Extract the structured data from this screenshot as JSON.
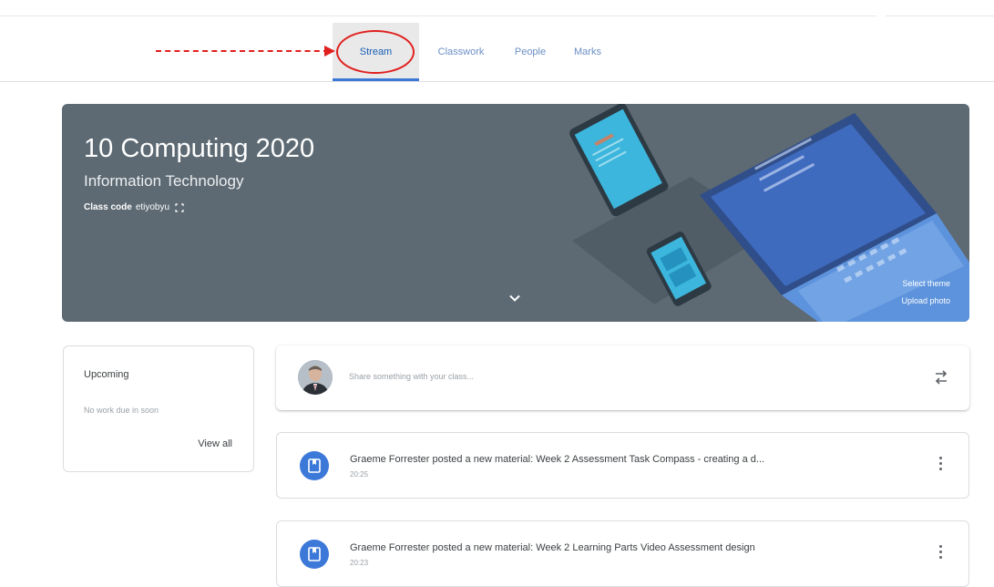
{
  "tabs": [
    {
      "label": "Stream",
      "active": true
    },
    {
      "label": "Classwork",
      "active": false
    },
    {
      "label": "People",
      "active": false
    },
    {
      "label": "Marks",
      "active": false
    }
  ],
  "banner": {
    "title": "10 Computing 2020",
    "subtitle": "Information Technology",
    "code_label": "Class code",
    "code_value": "etiyobyu",
    "select_theme": "Select theme",
    "upload_photo": "Upload photo",
    "background_color": "#5d6a73"
  },
  "upcoming": {
    "title": "Upcoming",
    "empty_text": "No work due in soon",
    "view_all": "View all"
  },
  "share": {
    "placeholder": "Share something with your class..."
  },
  "posts": [
    {
      "title": "Graeme Forrester posted a new material: Week 2 Assessment Task Compass - creating a d...",
      "time": "20:25"
    },
    {
      "title": "Graeme Forrester posted a new material: Week 2 Learning Parts Video Assessment design",
      "time": "20:23"
    }
  ],
  "colors": {
    "accent": "#3b78d8",
    "annotation": "#e0201e"
  },
  "icons": {
    "expand": "fullscreen-icon",
    "chevron": "chevron-down-icon",
    "repost": "repost-icon",
    "material": "material-icon",
    "menu": "more-vert-icon"
  }
}
